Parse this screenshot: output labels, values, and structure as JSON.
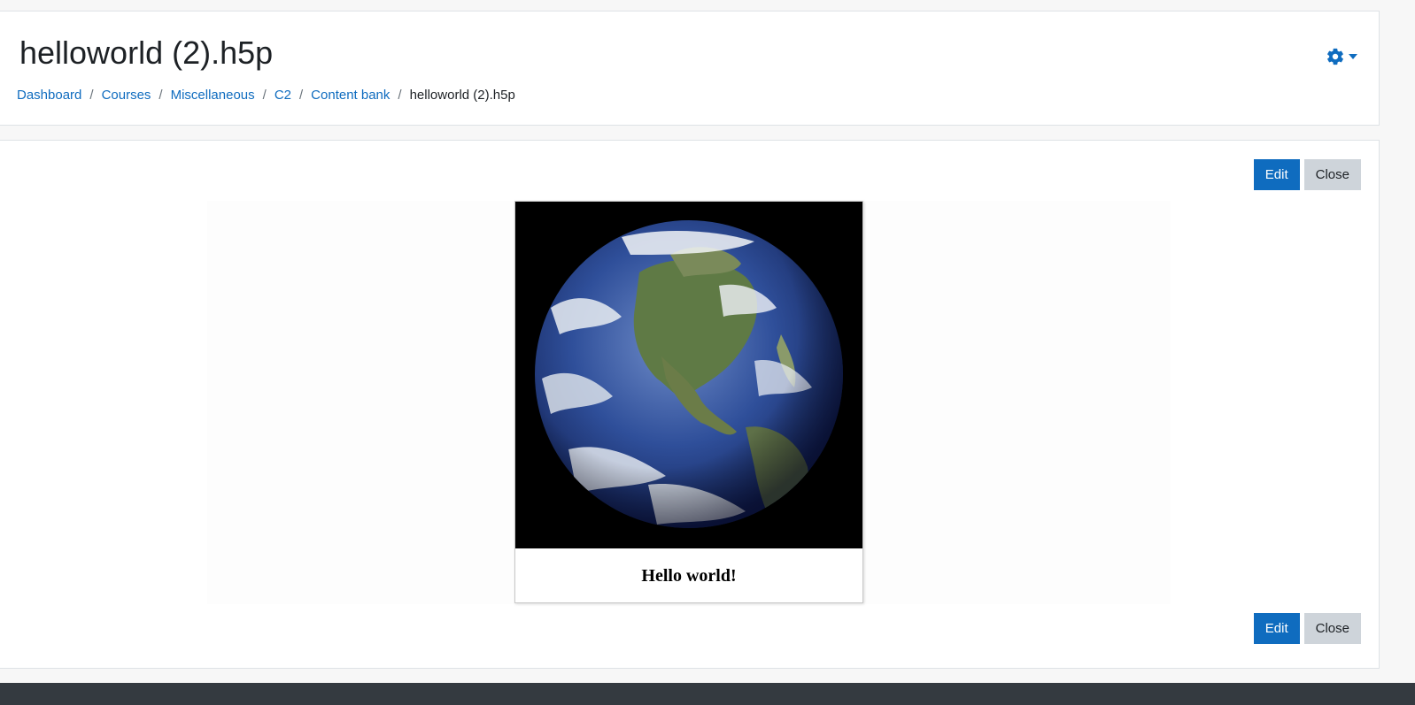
{
  "page": {
    "title": "helloworld (2).h5p"
  },
  "breadcrumb": {
    "items": [
      {
        "label": "Dashboard"
      },
      {
        "label": "Courses"
      },
      {
        "label": "Miscellaneous"
      },
      {
        "label": "C2"
      },
      {
        "label": "Content bank"
      }
    ],
    "current": "helloworld (2).h5p",
    "separator": "/"
  },
  "actions": {
    "edit_label": "Edit",
    "close_label": "Close"
  },
  "settings_menu": {
    "icon": "gear-icon",
    "caret": "caret-down-icon"
  },
  "h5p": {
    "image": "earth-globe-image",
    "caption": "Hello world!"
  },
  "colors": {
    "primary": "#0f6cbf",
    "secondary": "#ced4da",
    "footer": "#343a40"
  }
}
